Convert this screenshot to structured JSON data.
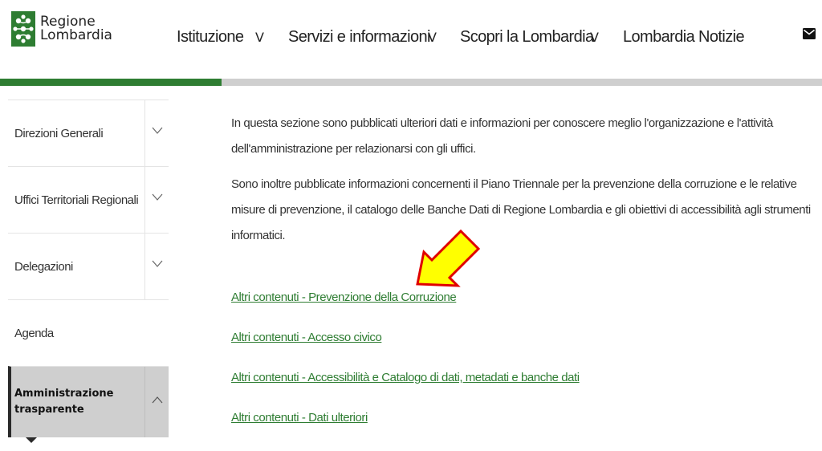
{
  "logo": {
    "line1": "Regione",
    "line2": "Lombardia",
    "icon": "rosa-camuna-logo-icon",
    "color": "#2e7d32"
  },
  "nav": {
    "items": [
      {
        "label": "Istituzione",
        "has_dropdown": true
      },
      {
        "label": "Servizi e informazioni",
        "has_dropdown": true
      },
      {
        "label": "Scopri la Lombardia",
        "has_dropdown": true
      },
      {
        "label": "Lombardia Notizie",
        "has_dropdown": false
      }
    ],
    "chevron": "ᐯ",
    "mail_icon": "envelope-icon"
  },
  "page_progress": {
    "fraction": 0.27,
    "fill_color": "#2e7d32",
    "track_color": "#cfcfcf"
  },
  "sidebar": {
    "items": [
      {
        "label": "Direzioni Generali",
        "expanded": false
      },
      {
        "label": "Uffici Territoriali Regionali",
        "expanded": false
      },
      {
        "label": "Delegazioni",
        "expanded": false
      },
      {
        "label": "Agenda"
      },
      {
        "label": "Amministrazione trasparente",
        "expanded": true,
        "active": true
      }
    ]
  },
  "main": {
    "paragraphs": [
      "In questa sezione sono pubblicati ulteriori dati e informazioni per conoscere meglio l'organizzazione e l'attività dell'amministrazione per relazionarsi con gli uffici.",
      "Sono inoltre pubblicate informazioni concernenti il Piano Triennale per la prevenzione della corruzione e le relative misure di prevenzione, il catalogo delle Banche Dati di Regione Lombardia e gli obiettivi di accessibilità agli strumenti informatici."
    ],
    "links": [
      "Altri contenuti - Prevenzione della Corruzione",
      "Altri contenuti - Accesso civico",
      "Altri contenuti - Accessibilità e Catalogo di dati, metadati e banche dati",
      "Altri contenuti - Dati ulteriori"
    ],
    "link_color": "#2e7d32"
  },
  "annotation": {
    "icon": "yellow-pointer-arrow-icon",
    "fill": "#ffff00",
    "stroke": "#e00000"
  }
}
